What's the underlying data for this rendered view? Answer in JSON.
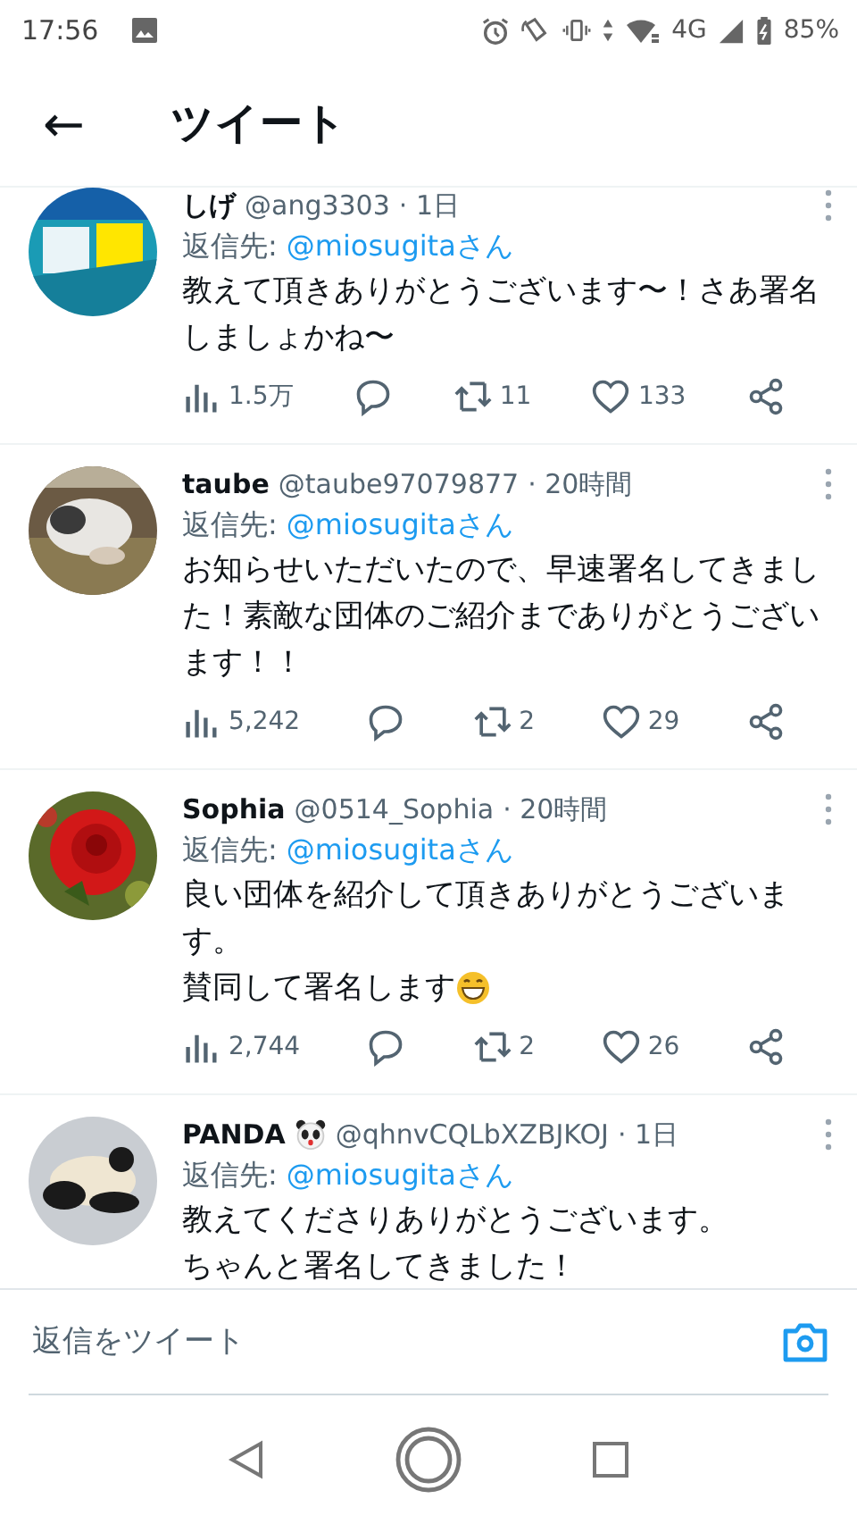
{
  "status_bar": {
    "time": "17:56",
    "network": "4G",
    "battery": "85%"
  },
  "header": {
    "back": "←",
    "title": "ツイート"
  },
  "tweets": [
    {
      "name": "しげ",
      "handle": "@ang3303",
      "time": "· 1日",
      "reply_label": "返信先:",
      "reply_to": "@miosugitaさん",
      "paragraphs": [
        "教えて頂きありがとうございます〜！さあ署名しましょかね〜"
      ],
      "emoji_in_name": false,
      "emoji_after_text": false,
      "stats": {
        "views": "1.5万",
        "retweets": "11",
        "likes": "133"
      }
    },
    {
      "name": "taube",
      "handle": "@taube97079877",
      "time": "· 20時間",
      "reply_label": "返信先:",
      "reply_to": "@miosugitaさん",
      "paragraphs": [
        "お知らせいただいたので、早速署名してきました！素敵な団体のご紹介までありがとうございます！！"
      ],
      "emoji_in_name": false,
      "emoji_after_text": false,
      "stats": {
        "views": "5,242",
        "retweets": "2",
        "likes": "29"
      }
    },
    {
      "name": "Sophia",
      "handle": "@0514_Sophia",
      "time": "· 20時間",
      "reply_label": "返信先:",
      "reply_to": "@miosugitaさん",
      "paragraphs": [
        "良い団体を紹介して頂きありがとうございます。",
        "賛同して署名します"
      ],
      "emoji_in_name": false,
      "emoji_after_text": true,
      "stats": {
        "views": "2,744",
        "retweets": "2",
        "likes": "26"
      }
    },
    {
      "name": "PANDA",
      "handle": "@qhnvCQLbXZBJKOJ",
      "time": "· 1日",
      "reply_label": "返信先:",
      "reply_to": "@miosugitaさん",
      "paragraphs": [
        "教えてくださりありがとうございます。",
        "ちゃんと署名してきました！"
      ],
      "emoji_in_name": true,
      "emoji_after_text": false
    }
  ],
  "reply_bar": {
    "placeholder": "返信をツイート"
  }
}
